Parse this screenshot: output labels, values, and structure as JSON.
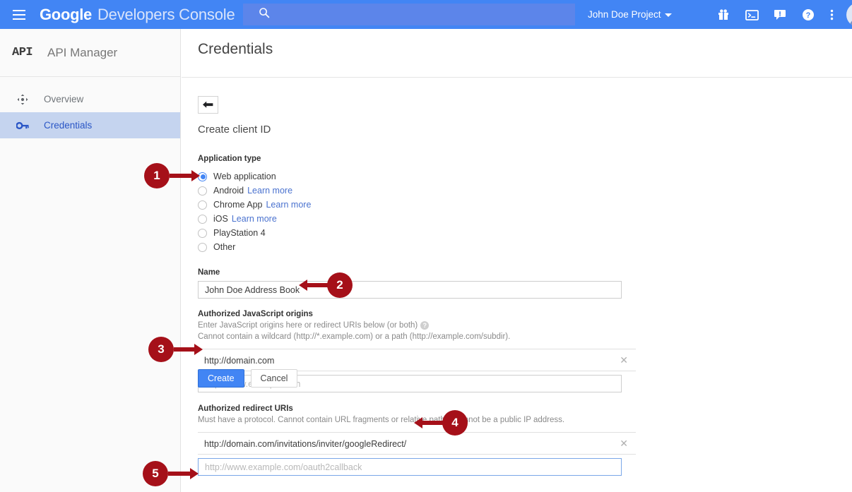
{
  "topbar": {
    "menu_icon": "hamburger-icon",
    "brand_primary": "Google",
    "brand_secondary": "Developers Console",
    "search_icon": "search-icon",
    "search_value": "",
    "search_placeholder": "",
    "project_name": "John Doe Project",
    "icons": [
      {
        "name": "gift-icon"
      },
      {
        "name": "cloud-shell-terminal-icon"
      },
      {
        "name": "feedback-icon"
      },
      {
        "name": "help-icon"
      },
      {
        "name": "more-vert-icon"
      }
    ],
    "avatar_name": "user-avatar",
    "bg_color": "#4285f4",
    "search_bg_color": "#5c85ea"
  },
  "sidebar": {
    "logo_text": "API",
    "title": "API Manager",
    "items": [
      {
        "label": "Overview",
        "icon": "move-cross-icon",
        "selected": false
      },
      {
        "label": "Credentials",
        "icon": "key-icon",
        "selected": true
      }
    ],
    "selected_bg_color": "#c5d4ef",
    "selected_text_color": "#2a56c6"
  },
  "main": {
    "page_title": "Credentials",
    "back_icon": "back-arrow-icon",
    "form_title": "Create client ID",
    "app_type": {
      "label": "Application type",
      "options": [
        {
          "label": "Web application",
          "link": "",
          "selected": true
        },
        {
          "label": "Android",
          "link": "Learn more",
          "selected": false
        },
        {
          "label": "Chrome App",
          "link": "Learn more",
          "selected": false
        },
        {
          "label": "iOS",
          "link": "Learn more",
          "selected": false
        },
        {
          "label": "PlayStation 4",
          "link": "",
          "selected": false
        },
        {
          "label": "Other",
          "link": "",
          "selected": false
        }
      ],
      "accent_color": "#4285f4"
    },
    "name_field": {
      "label": "Name",
      "value": "John Doe Address Book",
      "placeholder": ""
    },
    "js_origins": {
      "label": "Authorized JavaScript origins",
      "help_line_1": "Enter JavaScript origins here or redirect URIs below (or both)",
      "help_icon": "help-circle-icon",
      "help_line_2": "Cannot contain a wildcard (http://*.example.com) or a path (http://example.com/subdir).",
      "entries": [
        {
          "value": "http://domain.com",
          "clear_icon": "clear-x-icon"
        }
      ],
      "new_entry_placeholder": "http://www.example.com",
      "new_entry_value": "",
      "new_entry_focused": false
    },
    "redirect_uris": {
      "label": "Authorized redirect URIs",
      "help_line_1": "Must have a protocol. Cannot contain URL fragments or relative paths. Cannot be a public IP address.",
      "entries": [
        {
          "value": "http://domain.com/invitations/inviter/googleRedirect/",
          "clear_icon": "clear-x-icon"
        }
      ],
      "new_entry_placeholder": "http://www.example.com/oauth2callback",
      "new_entry_value": "",
      "new_entry_focused": true
    },
    "buttons": {
      "create": "Create",
      "cancel": "Cancel",
      "create_color": "#4285f4"
    }
  },
  "callouts": {
    "color": "#a51019",
    "items": [
      {
        "number": "1",
        "target": "web-application-radio"
      },
      {
        "number": "2",
        "target": "name-input"
      },
      {
        "number": "3",
        "target": "js-origin-entry"
      },
      {
        "number": "4",
        "target": "redirect-uri-entry"
      },
      {
        "number": "5",
        "target": "create-button"
      }
    ]
  }
}
